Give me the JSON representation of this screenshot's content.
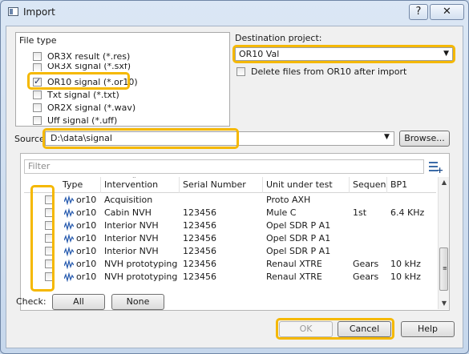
{
  "window": {
    "title": "Import",
    "help_glyph": "?",
    "close_glyph": "✕"
  },
  "file_type": {
    "title": "File type",
    "items": [
      {
        "label": "OR3X result (*.res)",
        "checked": false
      },
      {
        "label": "OR3X signal (*.sxf)",
        "checked": false
      },
      {
        "label": "OR10 signal (*.or10)",
        "checked": true
      },
      {
        "label": "Txt signal (*.txt)",
        "checked": false
      },
      {
        "label": "OR2X signal (*.wav)",
        "checked": false
      },
      {
        "label": "Uff signal (*.uff)",
        "checked": false
      }
    ]
  },
  "destination": {
    "label": "Destination project:",
    "value": "OR10 Val",
    "delete_label": "Delete files from OR10 after import"
  },
  "source": {
    "label": "Source:",
    "value": "D:\\data\\signal",
    "browse_label": "Browse..."
  },
  "filter": {
    "placeholder": "Filter"
  },
  "table": {
    "columns": [
      "Type",
      "Intervention",
      "Serial Number",
      "Unit under test",
      "Sequenc",
      "BP1"
    ],
    "rows": [
      [
        "or10",
        "Acquisition",
        "",
        "Proto AXH",
        "",
        ""
      ],
      [
        "or10",
        "Cabin NVH",
        "123456",
        "Mule C",
        "1st",
        "6.4 KHz"
      ],
      [
        "or10",
        "Interior NVH",
        "123456",
        "Opel SDR P A1",
        "",
        ""
      ],
      [
        "or10",
        "Interior NVH",
        "123456",
        "Opel SDR P A1",
        "",
        ""
      ],
      [
        "or10",
        "Interior NVH",
        "123456",
        "Opel SDR P A1",
        "",
        ""
      ],
      [
        "or10",
        "NVH prototyping",
        "123456",
        "Renaul XTRE",
        "Gears",
        "10 kHz"
      ],
      [
        "or10",
        "NVH prototyping",
        "123456",
        "Renaul XTRE",
        "Gears",
        "10 kHz"
      ]
    ]
  },
  "check": {
    "label": "Check:",
    "all_label": "All",
    "none_label": "None"
  },
  "buttons": {
    "ok": "OK",
    "cancel": "Cancel",
    "help": "Help"
  },
  "highlight_color": "#f5b800"
}
